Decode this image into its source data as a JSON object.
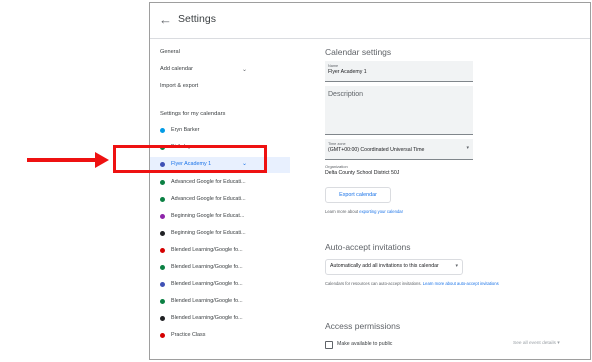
{
  "header": {
    "back_glyph": "←",
    "title": "Settings"
  },
  "sidebar": {
    "general": "General",
    "add_calendar": "Add calendar",
    "import_export": "Import & export",
    "my_calendars_heading": "Settings for my calendars",
    "calendars": [
      {
        "name": "Eryn Barker",
        "color": "#039be5"
      },
      {
        "name": "Birthdays",
        "color": "#0b8043"
      },
      {
        "name": "Flyer Academy 1",
        "color": "#3f51b5"
      },
      {
        "name": "Advanced Google for Educati...",
        "color": "#0b8043"
      },
      {
        "name": "Advanced Google for Educati...",
        "color": "#0b8043"
      },
      {
        "name": "Beginning Google for Educat...",
        "color": "#8e24aa"
      },
      {
        "name": "Beginning Google for Educati...",
        "color": "#202124"
      },
      {
        "name": "Blended Learning/Google fo...",
        "color": "#d50000"
      },
      {
        "name": "Blended Learning/Google fo...",
        "color": "#0b8043"
      },
      {
        "name": "Blended Learning/Google fo...",
        "color": "#3f51b5"
      },
      {
        "name": "Blended Learning/Google fo...",
        "color": "#0b8043"
      },
      {
        "name": "Blended Learning/Google fo...",
        "color": "#202124"
      },
      {
        "name": "Practice Class",
        "color": "#d50000"
      }
    ]
  },
  "main": {
    "calendar_settings_title": "Calendar settings",
    "name_label": "Name",
    "name_value": "Flyer Academy 1",
    "description_placeholder": "Description",
    "timezone_label": "Time zone",
    "timezone_value": "(GMT+00:00) Coordinated Universal Time",
    "org_label": "Organization",
    "org_value": "Delta County School District 50J",
    "export_button": "Export calendar",
    "export_help_prefix": "Learn more about",
    "export_help_link": "exporting your calendar",
    "auto_accept_title": "Auto-accept invitations",
    "auto_accept_value": "Automatically add all invitations to this calendar",
    "auto_accept_help": "Calendars for resources can auto-accept invitations.",
    "auto_accept_help_link": "Learn more about auto-accept invitations",
    "access_title": "Access permissions",
    "public_label": "Make available to public",
    "public_detail": "See all event details"
  },
  "colors": {
    "accent": "#1a73e8",
    "annotation": "#ee1111"
  }
}
